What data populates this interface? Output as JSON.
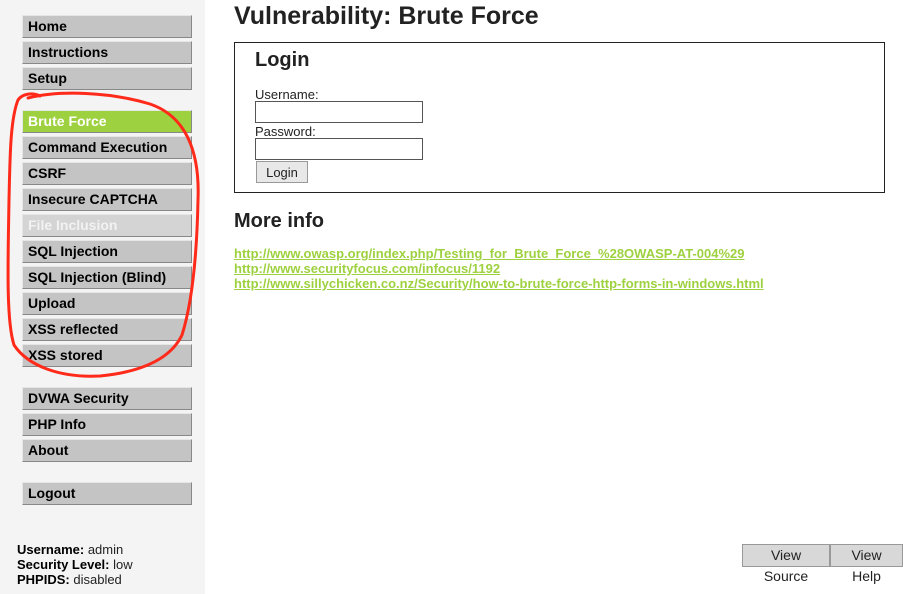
{
  "sidebar": {
    "group1": [
      "Home",
      "Instructions",
      "Setup"
    ],
    "group2": [
      {
        "label": "Brute Force",
        "state": "active"
      },
      {
        "label": "Command Execution",
        "state": "normal"
      },
      {
        "label": "CSRF",
        "state": "normal"
      },
      {
        "label": "Insecure CAPTCHA",
        "state": "normal"
      },
      {
        "label": "File Inclusion",
        "state": "disabled"
      },
      {
        "label": "SQL Injection",
        "state": "normal"
      },
      {
        "label": "SQL Injection (Blind)",
        "state": "normal"
      },
      {
        "label": "Upload",
        "state": "normal"
      },
      {
        "label": "XSS reflected",
        "state": "normal"
      },
      {
        "label": "XSS stored",
        "state": "normal"
      }
    ],
    "group3": [
      "DVWA Security",
      "PHP Info",
      "About"
    ],
    "group4": [
      "Logout"
    ]
  },
  "status": {
    "username_label": "Username:",
    "username_value": "admin",
    "security_label": "Security Level:",
    "security_value": "low",
    "phpids_label": "PHPIDS:",
    "phpids_value": "disabled"
  },
  "main": {
    "title": "Vulnerability: Brute Force",
    "login": {
      "title": "Login",
      "username_label": "Username:",
      "username_value": "",
      "password_label": "Password:",
      "password_value": "",
      "button": "Login"
    },
    "more_info_title": "More info",
    "links": [
      "http://www.owasp.org/index.php/Testing_for_Brute_Force_%28OWASP-AT-004%29",
      "http://www.securityfocus.com/infocus/1192",
      "http://www.sillychicken.co.nz/Security/how-to-brute-force-http-forms-in-windows.html"
    ]
  },
  "footer_buttons": {
    "view_source": "View Source",
    "view_help": "View Help"
  },
  "colors": {
    "accent": "#9ed13f",
    "menu": "#c4c4c4",
    "annotation": "#ff2a1a"
  }
}
